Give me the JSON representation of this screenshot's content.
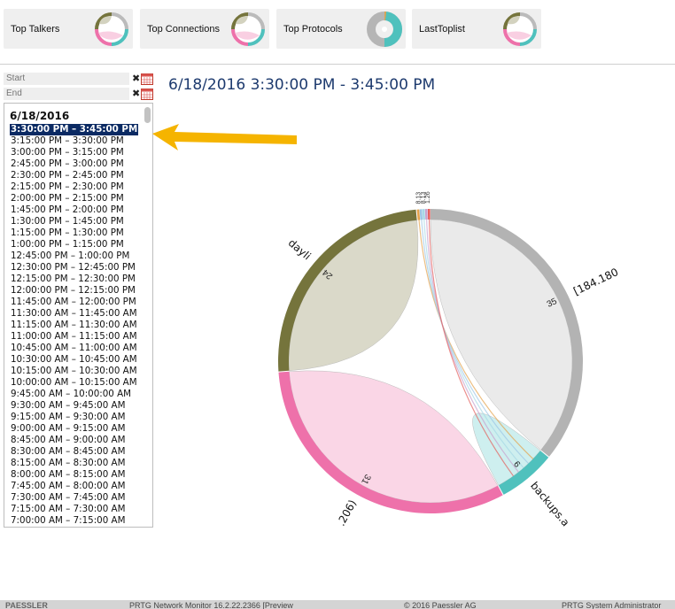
{
  "tiles": [
    {
      "label": "Top Talkers",
      "icon": "chord-mini-icon"
    },
    {
      "label": "Top Connections",
      "icon": "chord-mini-icon"
    },
    {
      "label": "Top Protocols",
      "icon": "donut-mini-icon"
    },
    {
      "label": "LastToplist",
      "icon": "chord-mini-icon"
    }
  ],
  "filter": {
    "start_placeholder": "Start",
    "end_placeholder": "End",
    "clear_glyph": "✖"
  },
  "list": {
    "date": "6/18/2016",
    "selected_index": 0,
    "items": [
      "3:30:00 PM – 3:45:00 PM",
      "3:15:00 PM – 3:30:00 PM",
      "3:00:00 PM – 3:15:00 PM",
      "2:45:00 PM – 3:00:00 PM",
      "2:30:00 PM – 2:45:00 PM",
      "2:15:00 PM – 2:30:00 PM",
      "2:00:00 PM – 2:15:00 PM",
      "1:45:00 PM – 2:00:00 PM",
      "1:30:00 PM – 1:45:00 PM",
      "1:15:00 PM – 1:30:00 PM",
      "1:00:00 PM – 1:15:00 PM",
      "12:45:00 PM – 1:00:00 PM",
      "12:30:00 PM – 12:45:00 PM",
      "12:15:00 PM – 12:30:00 PM",
      "12:00:00 PM – 12:15:00 PM",
      "11:45:00 AM – 12:00:00 PM",
      "11:30:00 AM – 11:45:00 AM",
      "11:15:00 AM – 11:30:00 AM",
      "11:00:00 AM – 11:15:00 AM",
      "10:45:00 AM – 11:00:00 AM",
      "10:30:00 AM – 10:45:00 AM",
      "10:15:00 AM – 10:30:00 AM",
      "10:00:00 AM – 10:15:00 AM",
      "9:45:00 AM – 10:00:00 AM",
      "9:30:00 AM – 9:45:00 AM",
      "9:15:00 AM – 9:30:00 AM",
      "9:00:00 AM – 9:15:00 AM",
      "8:45:00 AM – 9:00:00 AM",
      "8:30:00 AM – 8:45:00 AM",
      "8:15:00 AM – 8:30:00 AM",
      "8:00:00 AM – 8:15:00 AM",
      "7:45:00 AM – 8:00:00 AM",
      "7:30:00 AM – 7:45:00 AM",
      "7:15:00 AM – 7:30:00 AM",
      "7:00:00 AM – 7:15:00 AM"
    ]
  },
  "title": "6/18/2016 3:30:00 PM - 3:45:00 PM",
  "chord": {
    "groups": [
      {
        "value": 35,
        "label": "[184.180",
        "color": "#b3b3b3",
        "ribbon": "#e6e6e6"
      },
      {
        "value": 6,
        "label": "backups.a",
        "color": "#4fc1bd",
        "ribbon": "#c6ecec"
      },
      {
        "value": 31,
        "label": ".206)",
        "color": "#ee71aa",
        "ribbon": "#f9cfe2"
      },
      {
        "value": 24,
        "label": "dayli",
        "color": "#75743c",
        "ribbon": "#d3d2bf"
      }
    ],
    "small_labels": [
      "8.13",
      "8.13",
      "1.26"
    ],
    "small_colors": [
      "#e4a24b",
      "#9cc6e6",
      "#a6d9e6",
      "#c8a3cf",
      "#e4605c"
    ]
  },
  "footer": {
    "brand": "PAESSLER",
    "product": "PRTG Network Monitor 16.2.22.2366 [Preview",
    "copyright": "© 2016 Paessler AG",
    "user": "PRTG System Administrator"
  },
  "colors": {
    "accent": "#1d3a6e",
    "selected": "#0b2a63",
    "arrow": "#f5b400"
  }
}
